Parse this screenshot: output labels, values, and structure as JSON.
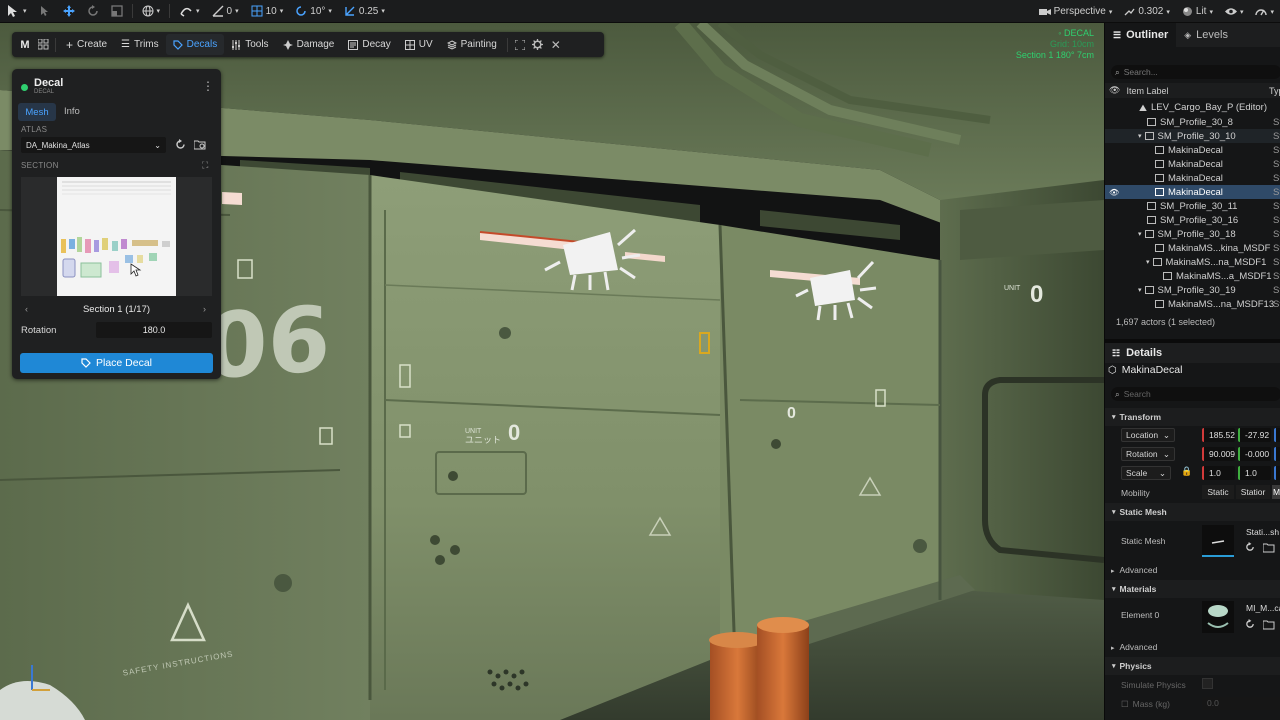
{
  "toolbar": {
    "zero_value": "0",
    "grid_snap": "10",
    "rotate_snap": "10°",
    "scale_snap": "0.25",
    "view_mode": "Perspective",
    "camera_speed": "0.302",
    "lighting": "Lit"
  },
  "mode_bar": {
    "items": [
      "Create",
      "Trims",
      "Decals",
      "Tools",
      "Damage",
      "Decay",
      "UV",
      "Painting"
    ],
    "active": "Decals",
    "m_label": "M"
  },
  "decal_panel": {
    "title": "Decal",
    "subtitle": "DECAL",
    "tabs": [
      "Mesh",
      "Info"
    ],
    "atlas_label": "ATLAS",
    "atlas_value": "DA_Makina_Atlas",
    "section_label": "SECTION",
    "section_nav": "Section 1 (1/17)",
    "rotation_label": "Rotation",
    "rotation_value": "180.0",
    "place_button": "Place Decal"
  },
  "viewport_info": {
    "line1": "◦ DECAL",
    "line2": "Grid: 10cm",
    "line3": "Section 1  180°  7cm"
  },
  "wall_text": {
    "big_number": "06",
    "unit_label": "UNIT",
    "unit_kana": "ユニット",
    "unit_zero": "0",
    "safety": "SAFETY INSTRUCTIONS"
  },
  "outliner": {
    "tab_outliner": "Outliner",
    "tab_levels": "Levels",
    "search_placeholder": "Search...",
    "col_label": "Item Label",
    "col_type": "Typ",
    "rows": [
      {
        "label": "LEV_Cargo_Bay_P (Editor)",
        "type": ""
      },
      {
        "label": "SM_Profile_30_8",
        "type": "St"
      },
      {
        "label": "SM_Profile_30_10",
        "type": "St"
      },
      {
        "label": "MakinaDecal",
        "type": "St"
      },
      {
        "label": "MakinaDecal",
        "type": "St"
      },
      {
        "label": "MakinaDecal",
        "type": "St"
      },
      {
        "label": "MakinaDecal",
        "type": "St"
      },
      {
        "label": "SM_Profile_30_11",
        "type": "St"
      },
      {
        "label": "SM_Profile_30_16",
        "type": "St"
      },
      {
        "label": "SM_Profile_30_18",
        "type": "St"
      },
      {
        "label": "MakinaMS...kina_MSDF",
        "type": "St"
      },
      {
        "label": "MakinaMS...na_MSDF1",
        "type": "St"
      },
      {
        "label": "MakinaMS...a_MSDF1",
        "type": "St"
      },
      {
        "label": "SM_Profile_30_19",
        "type": "St"
      },
      {
        "label": "MakinaMS...na_MSDF13",
        "type": "St"
      }
    ],
    "status": "1,697 actors (1 selected)"
  },
  "details": {
    "tab": "Details",
    "object": "MakinaDecal",
    "search_placeholder": "Search",
    "transform_header": "Transform",
    "location_label": "Location",
    "location_x": "185.52",
    "location_y": "-27.92",
    "location_z": "1",
    "rotation_label": "Rotation",
    "rotation_x": "90.009",
    "rotation_y": "-0.000",
    "rotation_z": "-",
    "scale_label": "Scale",
    "scale_x": "1.0",
    "scale_y": "1.0",
    "scale_z": "1",
    "mobility_label": "Mobility",
    "mobility_static": "Static",
    "mobility_stationary": "Statior",
    "mobility_m": "M",
    "static_mesh_header": "Static Mesh",
    "static_mesh_label": "Static Mesh",
    "static_mesh_value": "Stati...sh",
    "advanced_label": "Advanced",
    "materials_header": "Materials",
    "element0_label": "Element 0",
    "element0_value": "MI_M...cal",
    "advanced2_label": "Advanced",
    "physics_header": "Physics",
    "simulate_label": "Simulate Physics",
    "mass_label": "Mass (kg)",
    "mass_value": "0.0"
  },
  "colors": {
    "accent": "#4aa3ff",
    "wall": "#7c8c68",
    "place_button": "#1f88d6",
    "selection": "#2f4a68"
  }
}
